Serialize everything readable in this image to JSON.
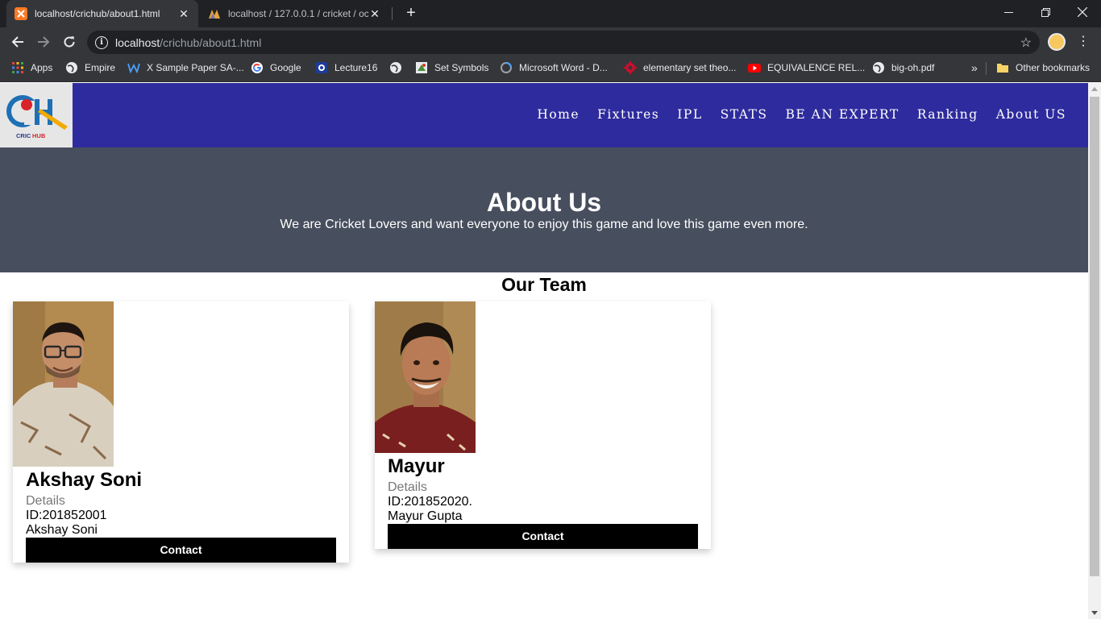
{
  "browser": {
    "tabs": [
      {
        "title": "localhost/crichub/about1.html",
        "active": true
      },
      {
        "title": "localhost / 127.0.0.1 / cricket / oc",
        "active": false
      }
    ],
    "address": {
      "host": "localhost",
      "path": "/crichub/about1.html"
    },
    "bookmarks": [
      {
        "label": "Apps",
        "icon": "apps-grid-icon"
      },
      {
        "label": "Empire",
        "icon": "globe-icon"
      },
      {
        "label": "X Sample Paper SA-...",
        "icon": "w-icon"
      },
      {
        "label": "Google",
        "icon": "google-icon"
      },
      {
        "label": "Lecture16",
        "icon": "lecture-icon"
      },
      {
        "label": "",
        "icon": "globe-icon"
      },
      {
        "label": "Set Symbols",
        "icon": "set-symbols-icon"
      },
      {
        "label": "Microsoft Word - D...",
        "icon": "loading-icon"
      },
      {
        "label": "elementary set theo...",
        "icon": "gear-icon"
      },
      {
        "label": "EQUIVALENCE REL...",
        "icon": "youtube-icon"
      },
      {
        "label": "big-oh.pdf",
        "icon": "globe-icon"
      }
    ],
    "overflow": "»",
    "other_bookmarks": "Other bookmarks"
  },
  "site": {
    "logo_text": "CRICHUB",
    "nav": [
      "Home",
      "Fixtures",
      "IPL",
      "STATS",
      "BE AN EXPERT",
      "Ranking",
      "About US"
    ],
    "hero": {
      "title": "About Us",
      "subtitle": "We are Cricket Lovers and want everyone to enjoy this game and love this game even more."
    },
    "team_title": "Our Team",
    "members": [
      {
        "name": "Akshay Soni",
        "details": "Details",
        "id": "ID:201852001",
        "full_name": "Akshay Soni",
        "contact": "Contact"
      },
      {
        "name": "Mayur",
        "details": "Details",
        "id": "ID:201852020.",
        "full_name": "Mayur Gupta",
        "contact": "Contact"
      }
    ]
  },
  "colors": {
    "nav_bg": "#2e2b9e",
    "hero_bg": "#474e5d",
    "button_bg": "#000000"
  }
}
